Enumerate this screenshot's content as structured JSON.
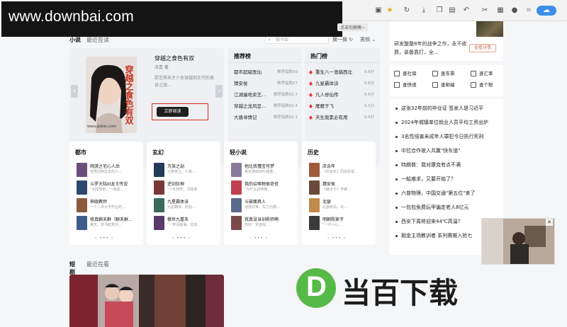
{
  "watermark_top": "www.downbai.com",
  "popover_label": "点击切换略~",
  "tabs": {
    "active": "小说",
    "inactive": "最近在读"
  },
  "search_placeholder": "搜书架",
  "change_label": "换一换",
  "gender_label": "男频",
  "featured": {
    "title": "穿越之食色有双",
    "author": "凌嘉 著",
    "desc": "厨艺界天才少女穿越到古代的美食之旅...",
    "read_button": "立即阅读",
    "cover_title": "穿越之食色有双",
    "cover_url": "www.qidian.com"
  },
  "recommend": {
    "title": "推荐榜",
    "rows": [
      {
        "name": "都市超级医仙",
        "meta": "推荐指数99"
      },
      {
        "name": "猜安侯",
        "meta": "推荐指数87"
      },
      {
        "name": "江湖遍地卖艺...",
        "meta": "推荐指数82.7"
      },
      {
        "name": "穿越之龙风呈...",
        "meta": "推荐指数82.4"
      },
      {
        "name": "大唐寻情记",
        "meta": "推荐指数82.1"
      }
    ]
  },
  "hot": {
    "title": "热门榜",
    "rows": [
      {
        "name": "重生八一渔猎西北",
        "score": "9.8分"
      },
      {
        "name": "九星霸体诀",
        "score": "9.8分"
      },
      {
        "name": "凡人修仙传",
        "score": "9.6分"
      },
      {
        "name": "雁雁于飞",
        "score": "9.5分"
      },
      {
        "name": "天生我素必有用",
        "score": "9.4分"
      }
    ]
  },
  "genres": [
    {
      "title": "都市",
      "items": [
        {
          "t": "网游之宅心人后",
          "s": "宅男回到过去的人..."
        },
        {
          "t": "斗罗大陆III龙王传说",
          "s": "\"大陆传奇，一战成..."
        },
        {
          "t": "神级教师",
          "s": "一个二本大学毕业的..."
        },
        {
          "t": "修真聊天群（聊天群...",
          "s": "某天，宋书航意外..."
        }
      ]
    },
    {
      "title": "玄幻",
      "items": [
        {
          "t": "万族之劫",
          "s": "万族林立，人族..."
        },
        {
          "t": "逆剑狂神",
          "s": "\"少年林轩，灵脉被..."
        },
        {
          "t": "九星霸体诀",
          "s": "九星霸体，原始..."
        },
        {
          "t": "傲世九重天",
          "s": "\"一笑风雨涌，仗剑..."
        }
      ]
    },
    {
      "title": "轻小说",
      "items": [
        {
          "t": "他比我懂宝可梦",
          "s": "真实游戏NPC我重..."
        },
        {
          "t": "我的召唤物很奇怪",
          "s": "\"为什么召唤物..."
        },
        {
          "t": "斗破面具人",
          "s": "他很对世，实力为尊..."
        },
        {
          "t": "我真没当训练师啊",
          "s": "你好！本游戏..."
        }
      ]
    },
    {
      "title": "历史",
      "items": [
        {
          "t": "庆余年",
          "s": "《庆余年》同名影视..."
        },
        {
          "t": "猜安侯",
          "s": "《献天子》作者..."
        },
        {
          "t": "北瑟",
          "s": "北瑟有凤，玄..."
        },
        {
          "t": "明朝败家子",
          "s": "\"一不小心，..."
        }
      ]
    }
  ],
  "pager": "‹ ••• ›",
  "shorts": {
    "title": "短剧",
    "recent": "最近在看"
  },
  "right_ad": {
    "text": "研发整整8年的战争之作，永不收费，装备靠打，全...",
    "button": "查看详情"
  },
  "services": [
    {
      "label": "查社保"
    },
    {
      "label": "查车票"
    },
    {
      "label": "查汇率"
    },
    {
      "label": "查快递"
    },
    {
      "label": "查邮编"
    },
    {
      "label": "查个税"
    }
  ],
  "news": [
    "这张32年前的毕业证 签发人是习近平",
    "2024年城镇单位就业人员平均工资出炉",
    "3名性侵害未成年人罪犯今日执行死刑",
    "中拉合作驶入共赢\"快车道\"",
    "特朗普：我对康克有点不满",
    "一船难求，又要开始了？",
    "六普物理，中国交通\"第五位\"来了",
    "一包包免费玩甲骗走老人8亿元",
    "西安下周将迎来44℃高温?",
    "掘金主场教训者 系列赛推入抢七"
  ],
  "logo": {
    "letter": "D",
    "text": "当百下载"
  },
  "colors": {
    "accent_red": "#d9291c",
    "logo_green": "#57b947",
    "hot_icon": "#e33333"
  }
}
